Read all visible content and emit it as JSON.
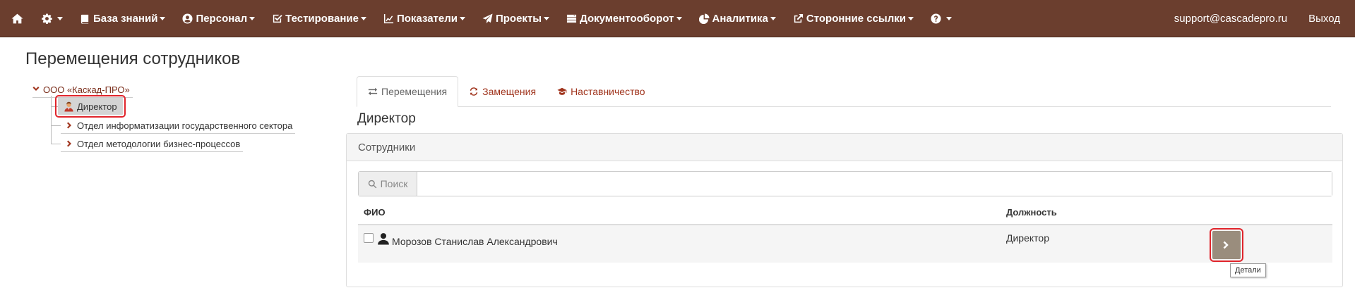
{
  "navbar": {
    "items": [
      {
        "label": "База знаний",
        "icon": "book-icon"
      },
      {
        "label": "Персонал",
        "icon": "user-circle-icon"
      },
      {
        "label": "Тестирование",
        "icon": "check-square-icon"
      },
      {
        "label": "Показатели",
        "icon": "line-chart-icon"
      },
      {
        "label": "Проекты",
        "icon": "paper-plane-icon"
      },
      {
        "label": "Документооборот",
        "icon": "server-icon"
      },
      {
        "label": "Аналитика",
        "icon": "pie-chart-icon"
      },
      {
        "label": "Сторонние ссылки",
        "icon": "external-link-icon"
      }
    ],
    "user_email": "support@cascadepro.ru",
    "logout_label": "Выход"
  },
  "page": {
    "title": "Перемещения сотрудников"
  },
  "tree": {
    "root": "ООО «Каскад-ПРО»",
    "selected": "Директор",
    "departments": [
      "Отдел информатизации государственного сектора",
      "Отдел методологии бизнес-процессов"
    ]
  },
  "tabs": [
    {
      "label": "Перемещения",
      "icon": "exchange-icon",
      "active": true
    },
    {
      "label": "Замещения",
      "icon": "refresh-icon",
      "active": false
    },
    {
      "label": "Наставничество",
      "icon": "graduation-cap-icon",
      "active": false
    }
  ],
  "section": {
    "heading": "Директор"
  },
  "panel": {
    "title": "Сотрудники",
    "search_addon": "Поиск",
    "search_value": "",
    "columns": {
      "name": "ФИО",
      "position": "Должность"
    },
    "rows": [
      {
        "name": "Морозов Станислав Александрович",
        "position": "Директор",
        "checked": false
      }
    ],
    "details_tooltip": "Детали"
  },
  "colors": {
    "navbar_bg": "#6b3e2e",
    "accent": "#a0341d",
    "highlight_border": "#e0242b",
    "details_button": "#9a8d7d"
  }
}
